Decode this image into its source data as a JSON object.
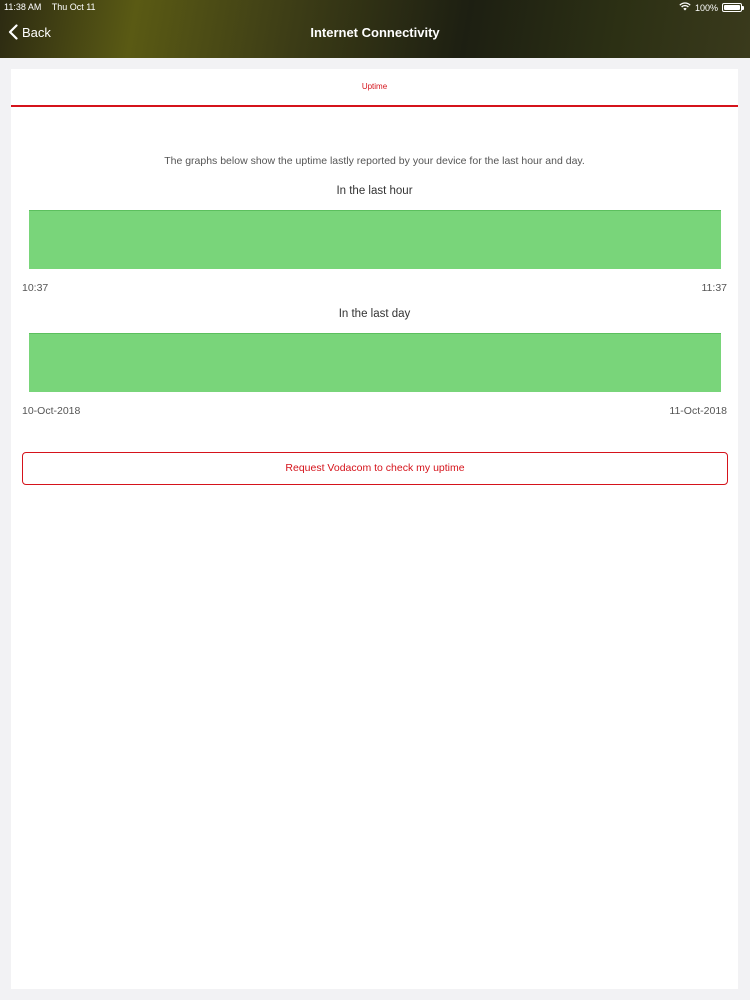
{
  "status_bar": {
    "time": "11:38 AM",
    "date": "Thu Oct 11",
    "battery": "100%",
    "battery_level": 1.0
  },
  "nav": {
    "back_label": "Back",
    "title": "Internet Connectivity"
  },
  "tabs": [
    {
      "label": "Uptime",
      "active": true
    }
  ],
  "description": "The graphs below show the uptime lastly reported by your device for the last hour and day.",
  "graphs": [
    {
      "title": "In the last hour",
      "start_label": "10:37",
      "end_label": "11:37",
      "uptime_fraction": 1.0
    },
    {
      "title": "In the last day",
      "start_label": "10-Oct-2018",
      "end_label": "11-Oct-2018",
      "uptime_fraction": 1.0
    }
  ],
  "colors": {
    "accent": "#d5131b",
    "uptime_green": "#79d57a"
  },
  "request_button": "Request Vodacom to check my uptime"
}
